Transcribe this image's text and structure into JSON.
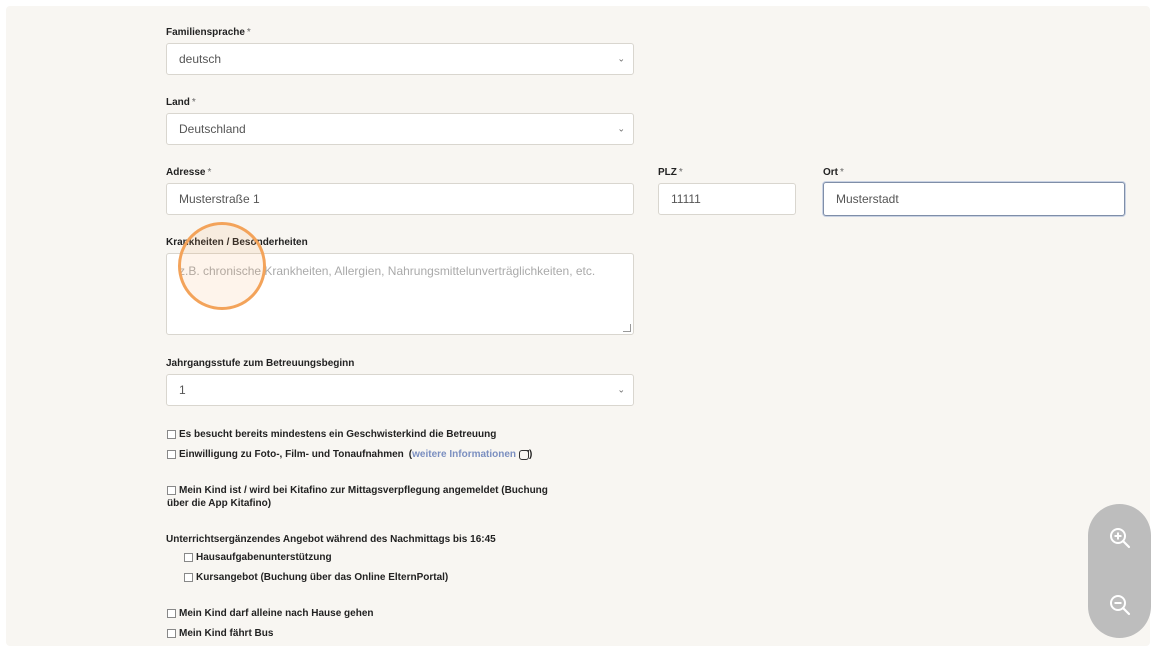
{
  "form": {
    "familiensprache": {
      "label": "Familiensprache",
      "req": "*",
      "value": "deutsch"
    },
    "land": {
      "label": "Land",
      "req": "*",
      "value": "Deutschland"
    },
    "adresse": {
      "label": "Adresse",
      "req": "*",
      "value": "Musterstraße 1"
    },
    "plz": {
      "label": "PLZ",
      "req": "*",
      "value": "11111"
    },
    "ort": {
      "label": "Ort",
      "req": "*",
      "value": "Musterstadt"
    },
    "krankheiten": {
      "label": "Krankheiten / Besonderheiten",
      "placeholder": "z.B. chronische Krankheiten, Allergien, Nahrungsmittelunverträglichkeiten, etc."
    },
    "jahrgang": {
      "label": "Jahrgangsstufe zum Betreuungsbeginn",
      "value": "1"
    },
    "checkboxes": {
      "geschwister": "Es besucht bereits mindestens ein Geschwisterkind die Betreuung",
      "einwilligung": "Einwilligung zu Foto-, Film- und Tonaufnahmen",
      "einwilligung_open": "(",
      "einwilligung_link": "weitere Informationen",
      "einwilligung_close": ")",
      "mittag_line1": "Mein Kind ist / wird bei Kitafino zur Mittagsverpflegung angemeldet (Buchung",
      "mittag_line2": "über die App Kitafino)",
      "nachmittag_heading": "Unterrichtsergänzendes Angebot während des Nachmittags bis 16:45",
      "hausaufgaben": "Hausaufgabenunterstützung",
      "kursangebot": "Kursangebot (Buchung über das Online ElternPortal)",
      "alleine": "Mein Kind darf alleine nach Hause gehen",
      "bus": "Mein Kind fährt Bus"
    }
  },
  "icons": {
    "select_chevron": "chevron-down-icon",
    "external_link": "external-link-icon",
    "zoom_in": "zoom-in-icon",
    "zoom_out": "zoom-out-icon"
  },
  "colors": {
    "panel_bg": "#f8f6f2",
    "link": "#7b8fc0",
    "click_ring": "#f3a35a",
    "zoom_bg": "#bdbdbd"
  }
}
